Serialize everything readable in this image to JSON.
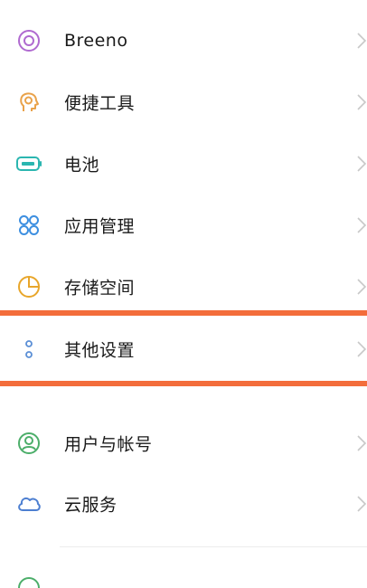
{
  "settings": {
    "items": [
      {
        "label": "Breeno",
        "icon": "breeno-icon"
      },
      {
        "label": "便捷工具",
        "icon": "convenience-tools-icon"
      },
      {
        "label": "电池",
        "icon": "battery-icon"
      },
      {
        "label": "应用管理",
        "icon": "app-management-icon"
      },
      {
        "label": "存储空间",
        "icon": "storage-icon"
      },
      {
        "label": "其他设置",
        "icon": "other-settings-icon"
      },
      {
        "label": "用户与帐号",
        "icon": "user-account-icon"
      },
      {
        "label": "云服务",
        "icon": "cloud-service-icon"
      }
    ]
  },
  "colors": {
    "highlight": "#f36d3b",
    "breeno": "#b06ad0",
    "tools": "#e9a24a",
    "battery": "#2bb6b0",
    "apps": "#3d8fe0",
    "storage": "#e8a62b",
    "other": "#5b8fd6",
    "user": "#4cae6a",
    "cloud": "#4d7fd1"
  }
}
